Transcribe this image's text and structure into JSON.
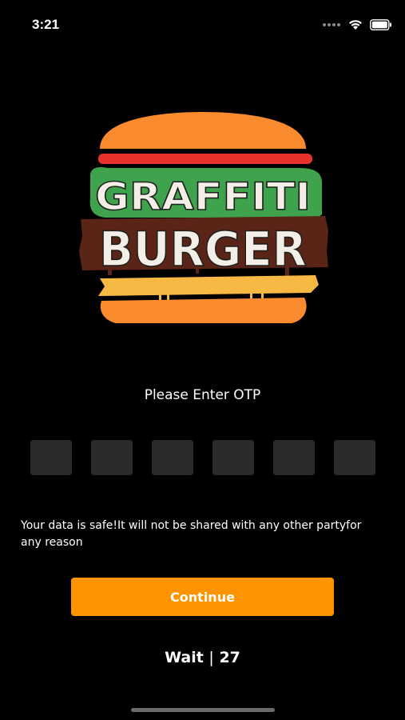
{
  "status_bar": {
    "time": "3:21",
    "icons": [
      "signal-dots-icon",
      "wifi-icon",
      "battery-icon"
    ]
  },
  "logo": {
    "line1": "GRAFFITI",
    "line2": "BURGER",
    "colors": {
      "bun": "#f98a2e",
      "red_stripe": "#e6322b",
      "lettuce": "#3fa34d",
      "patty": "#5a2516",
      "cheese": "#f7b844",
      "letters": "#f3efe6"
    }
  },
  "otp": {
    "title": "Please Enter OTP",
    "boxes": [
      "",
      "",
      "",
      "",
      "",
      ""
    ]
  },
  "note": "Your data is safe!It will not be shared with any other partyfor any reason",
  "continue_label": "Continue",
  "wait": {
    "label": "Wait",
    "separator": "|",
    "seconds": "27"
  },
  "colors": {
    "background": "#000000",
    "accent": "#ff9400",
    "input_bg": "#2a2a2a"
  }
}
